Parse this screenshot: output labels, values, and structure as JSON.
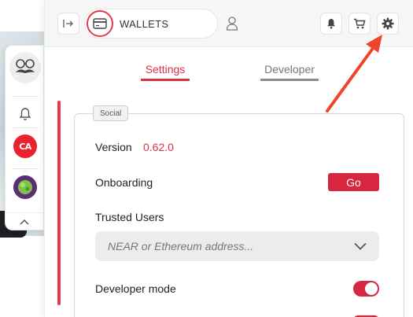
{
  "header": {
    "wallets_label": "WALLETS"
  },
  "tabs": [
    {
      "label": "Settings",
      "active": true
    },
    {
      "label": "Developer",
      "active": false
    }
  ],
  "section": {
    "tag": "Social",
    "version_label": "Version",
    "version_value": "0.62.0",
    "onboarding_label": "Onboarding",
    "go_label": "Go",
    "trusted_users_label": "Trusted Users",
    "address_placeholder": "NEAR or Ethereum address...",
    "developer_mode_label": "Developer mode",
    "developer_mode_on": true
  },
  "rail": {
    "ca_app_text": "CA"
  },
  "colors": {
    "accent": "#d8324a",
    "go_button": "#d7263f",
    "annotation_arrow": "#f0442a"
  },
  "icons": [
    "collapse-panel-icon",
    "wallet-card-icon",
    "user-icon",
    "bell-icon",
    "cart-icon",
    "gear-icon",
    "mustache-avatar-icon",
    "chevron-down-icon",
    "chevron-up-icon"
  ]
}
